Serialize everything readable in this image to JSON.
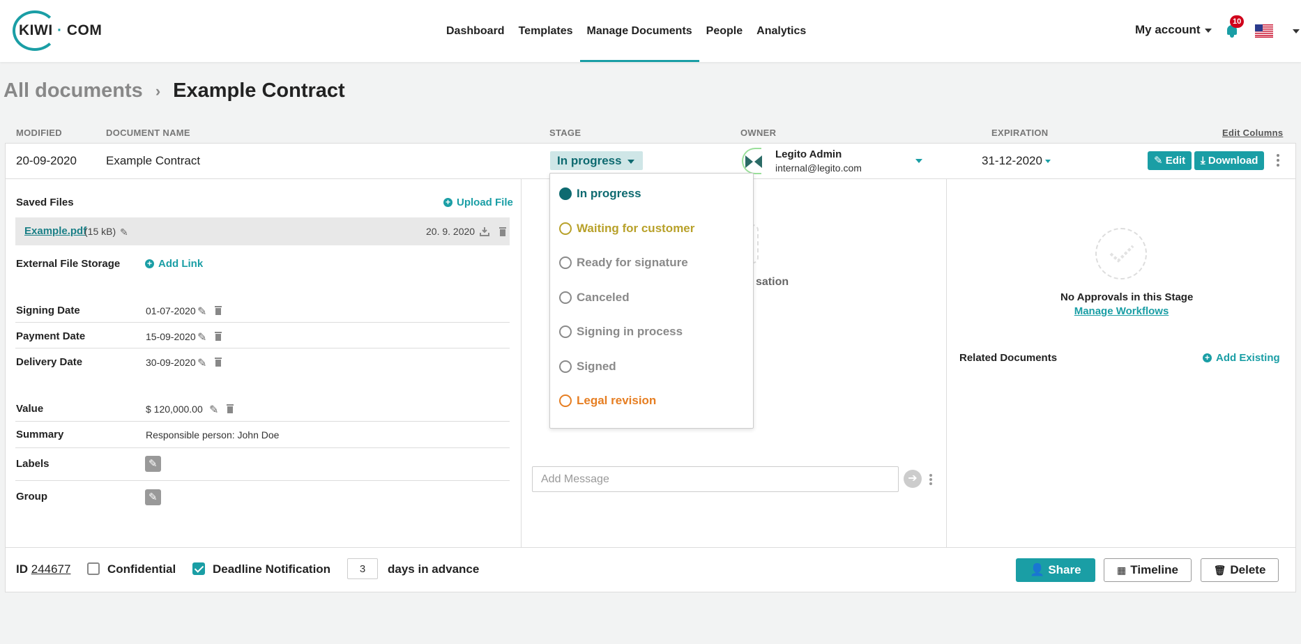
{
  "header": {
    "logo_left": "KIWI",
    "logo_dot": "·",
    "logo_right": "COM",
    "nav": [
      "Dashboard",
      "Templates",
      "Manage Documents",
      "People",
      "Analytics"
    ],
    "active_nav": "Manage Documents",
    "account_label": "My account",
    "notifications_count": "10",
    "accent_color": "#1a9ea5"
  },
  "breadcrumb": {
    "parent": "All documents",
    "current": "Example Contract"
  },
  "columns": {
    "modified": "MODIFIED",
    "document_name": "DOCUMENT NAME",
    "stage": "STAGE",
    "owner": "OWNER",
    "expiration": "EXPIRATION",
    "edit_columns": "Edit Columns"
  },
  "document": {
    "modified": "20-09-2020",
    "name": "Example Contract",
    "stage": "In progress",
    "owner_name": "Legito Admin",
    "owner_email": "internal@legito.com",
    "expiration": "31-12-2020",
    "edit_label": "Edit",
    "download_label": "Download"
  },
  "left": {
    "saved_files_label": "Saved Files",
    "upload_label": "Upload File",
    "file": {
      "name": "Example.pdf",
      "size": "(15 kB)",
      "date": "20. 9. 2020"
    },
    "external_storage_label": "External File Storage",
    "add_link_label": "Add Link",
    "signing_date_label": "Signing Date",
    "signing_date": "01-07-2020",
    "payment_date_label": "Payment Date",
    "payment_date": "15-09-2020",
    "delivery_date_label": "Delivery Date",
    "delivery_date": "30-09-2020",
    "value_label": "Value",
    "value": "$ 120,000.00",
    "summary_label": "Summary",
    "summary": "Responsible person: John Doe",
    "labels_label": "Labels",
    "group_label": "Group"
  },
  "stage_dropdown": {
    "items": [
      {
        "label": "In progress",
        "color": "#0e6a70",
        "selected": true
      },
      {
        "label": "Waiting for customer",
        "color": "#b8a12a",
        "selected": false
      },
      {
        "label": "Ready for signature",
        "color": "#8a8a8a",
        "selected": false
      },
      {
        "label": "Canceled",
        "color": "#8a8a8a",
        "selected": false
      },
      {
        "label": "Signing in process",
        "color": "#8a8a8a",
        "selected": false
      },
      {
        "label": "Signed",
        "color": "#8a8a8a",
        "selected": false
      },
      {
        "label": "Legal revision",
        "color": "#e67e22",
        "selected": false
      }
    ]
  },
  "middle": {
    "partial_text": "sation",
    "message_placeholder": "Add Message"
  },
  "right": {
    "no_approvals": "No Approvals in this Stage",
    "manage_workflows": "Manage Workflows",
    "related_documents_label": "Related Documents",
    "add_existing_label": "Add Existing"
  },
  "footer": {
    "id_label": "ID",
    "id_value": "244677",
    "confidential_label": "Confidential",
    "confidential_checked": false,
    "deadline_label": "Deadline Notification",
    "deadline_checked": true,
    "days_value": "3",
    "days_suffix": "days in advance",
    "share_label": "Share",
    "timeline_label": "Timeline",
    "delete_label": "Delete"
  }
}
